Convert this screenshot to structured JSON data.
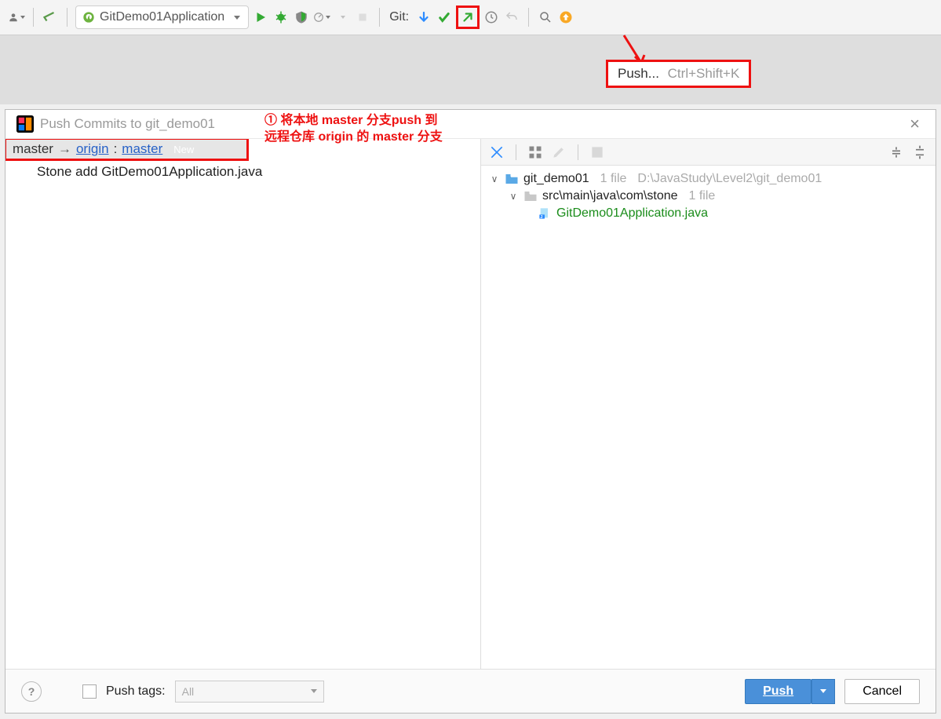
{
  "toolbar": {
    "run_config": "GitDemo01Application",
    "git_label": "Git:"
  },
  "tooltip": {
    "label": "Push...",
    "shortcut": "Ctrl+Shift+K"
  },
  "annotations": {
    "one_line1": "① 将本地 master 分支push 到",
    "one_line2": "远程仓库 origin 的 master 分支"
  },
  "dialog": {
    "title": "Push Commits to git_demo01",
    "branch": {
      "local": "master",
      "remote": "origin",
      "colon": ":",
      "remote_branch": "master",
      "badge": "New"
    },
    "commits": [
      "Stone add GitDemo01Application.java"
    ],
    "tree": {
      "root": {
        "name": "git_demo01",
        "meta_count": "1 file",
        "meta_path": "D:\\JavaStudy\\Level2\\git_demo01"
      },
      "folder": {
        "name": "src\\main\\java\\com\\stone",
        "meta_count": "1 file"
      },
      "file": {
        "name": "GitDemo01Application.java"
      }
    },
    "footer": {
      "push_tags_label": "Push tags:",
      "tag_option": "All",
      "push_btn": "Push",
      "cancel_btn": "Cancel"
    }
  }
}
